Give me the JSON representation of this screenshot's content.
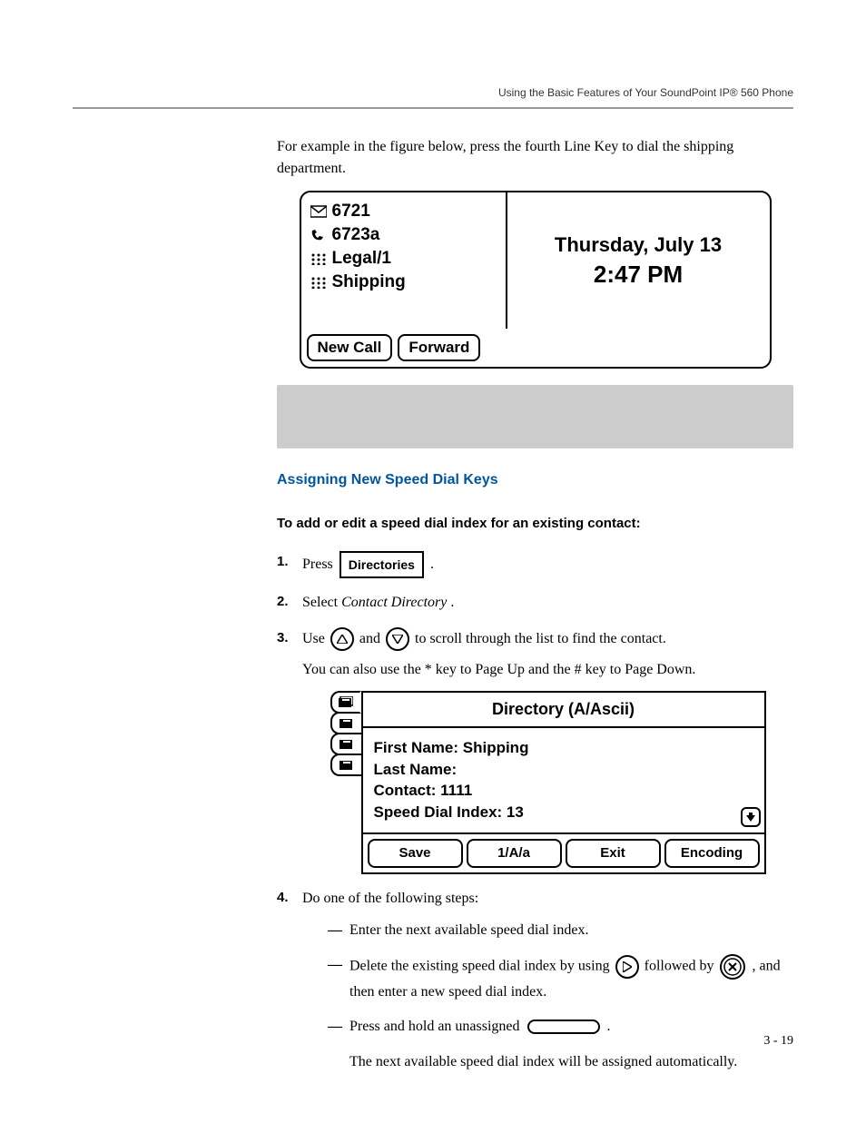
{
  "runningHead": "Using the Basic Features of Your SoundPoint IP® 560 Phone",
  "introPara": "For example in the figure below, press the fourth Line Key to dial the shipping department.",
  "lcd1": {
    "lines": [
      "6721",
      "6723a",
      "Legal/1",
      "Shipping"
    ],
    "dateLine": "Thursday, July 13",
    "timeLine": "2:47 PM",
    "softkeys": [
      "New Call",
      "Forward"
    ]
  },
  "sectionHead": "Assigning New Speed Dial Keys",
  "subHead": "To add or edit a speed dial index for an existing contact:",
  "step1_a": "Press ",
  "btnDirectories": "Directories",
  "step1_b": " .",
  "step2_a": "Select ",
  "step2_em": "Contact Directory",
  "step2_b": ".",
  "step3_a": "Use ",
  "step3_b": " and ",
  "step3_c": " to scroll through the list to find the contact.",
  "step3_para": "You can also use the * key to Page Up and the # key to Page Down.",
  "lcd2": {
    "title": "Directory (A/Ascii)",
    "f1": "First Name: Shipping",
    "f2": "Last Name:",
    "f3": "Contact: 1111",
    "f4": "Speed Dial Index: 13",
    "softkeys": [
      "Save",
      "1/A/a",
      "Exit",
      "Encoding"
    ]
  },
  "step4": "Do one of the following steps:",
  "sub1": "Enter the next available speed dial index.",
  "sub2_a": "Delete the existing speed dial index by using ",
  "sub2_b": " followed by ",
  "sub2_c": ", and then enter a new speed dial index.",
  "sub3_a": "Press and hold an unassigned ",
  "sub3_b": ".",
  "sub3_para": "The next available speed dial index will be assigned automatically.",
  "pageNum": "3 - 19"
}
